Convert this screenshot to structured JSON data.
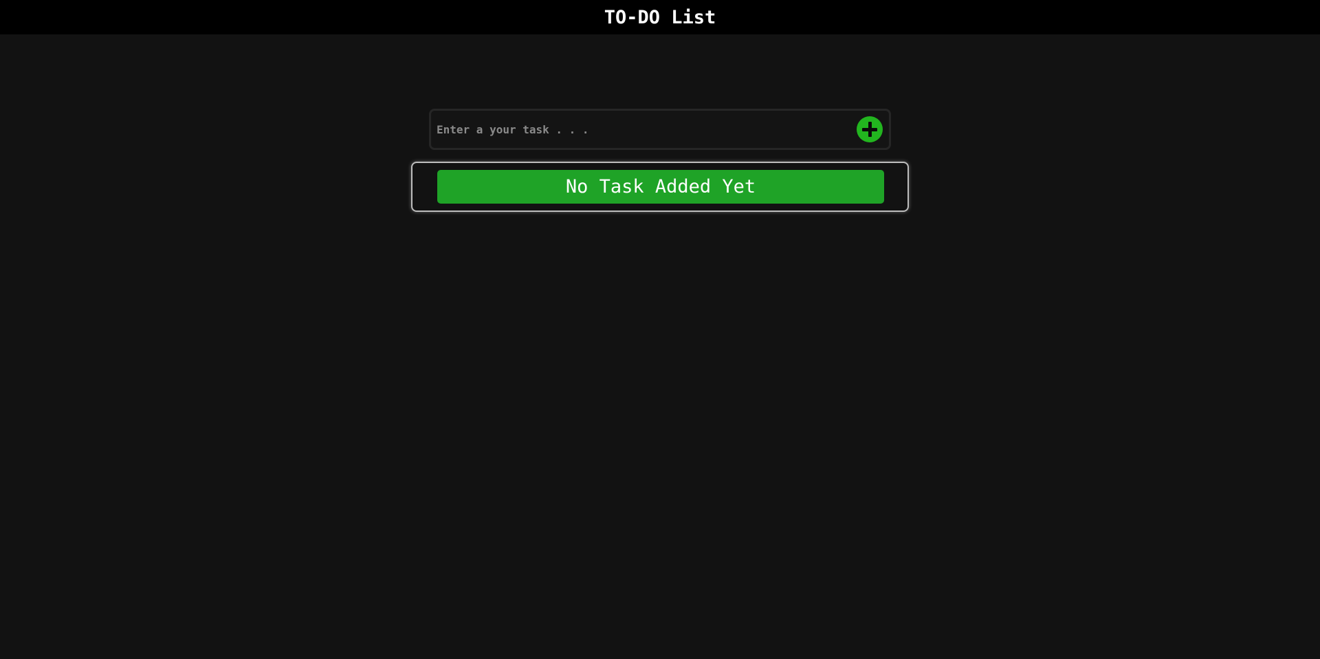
{
  "header": {
    "title": "TO-DO List"
  },
  "task_input": {
    "value": "",
    "placeholder": "Enter a your task . . .",
    "add_icon": "plus-circle-icon"
  },
  "task_list": {
    "empty_message": "No Task Added Yet"
  },
  "colors": {
    "background": "#121212",
    "header_background": "#000000",
    "accent_green": "#22b51f",
    "banner_green": "#1fa327"
  }
}
